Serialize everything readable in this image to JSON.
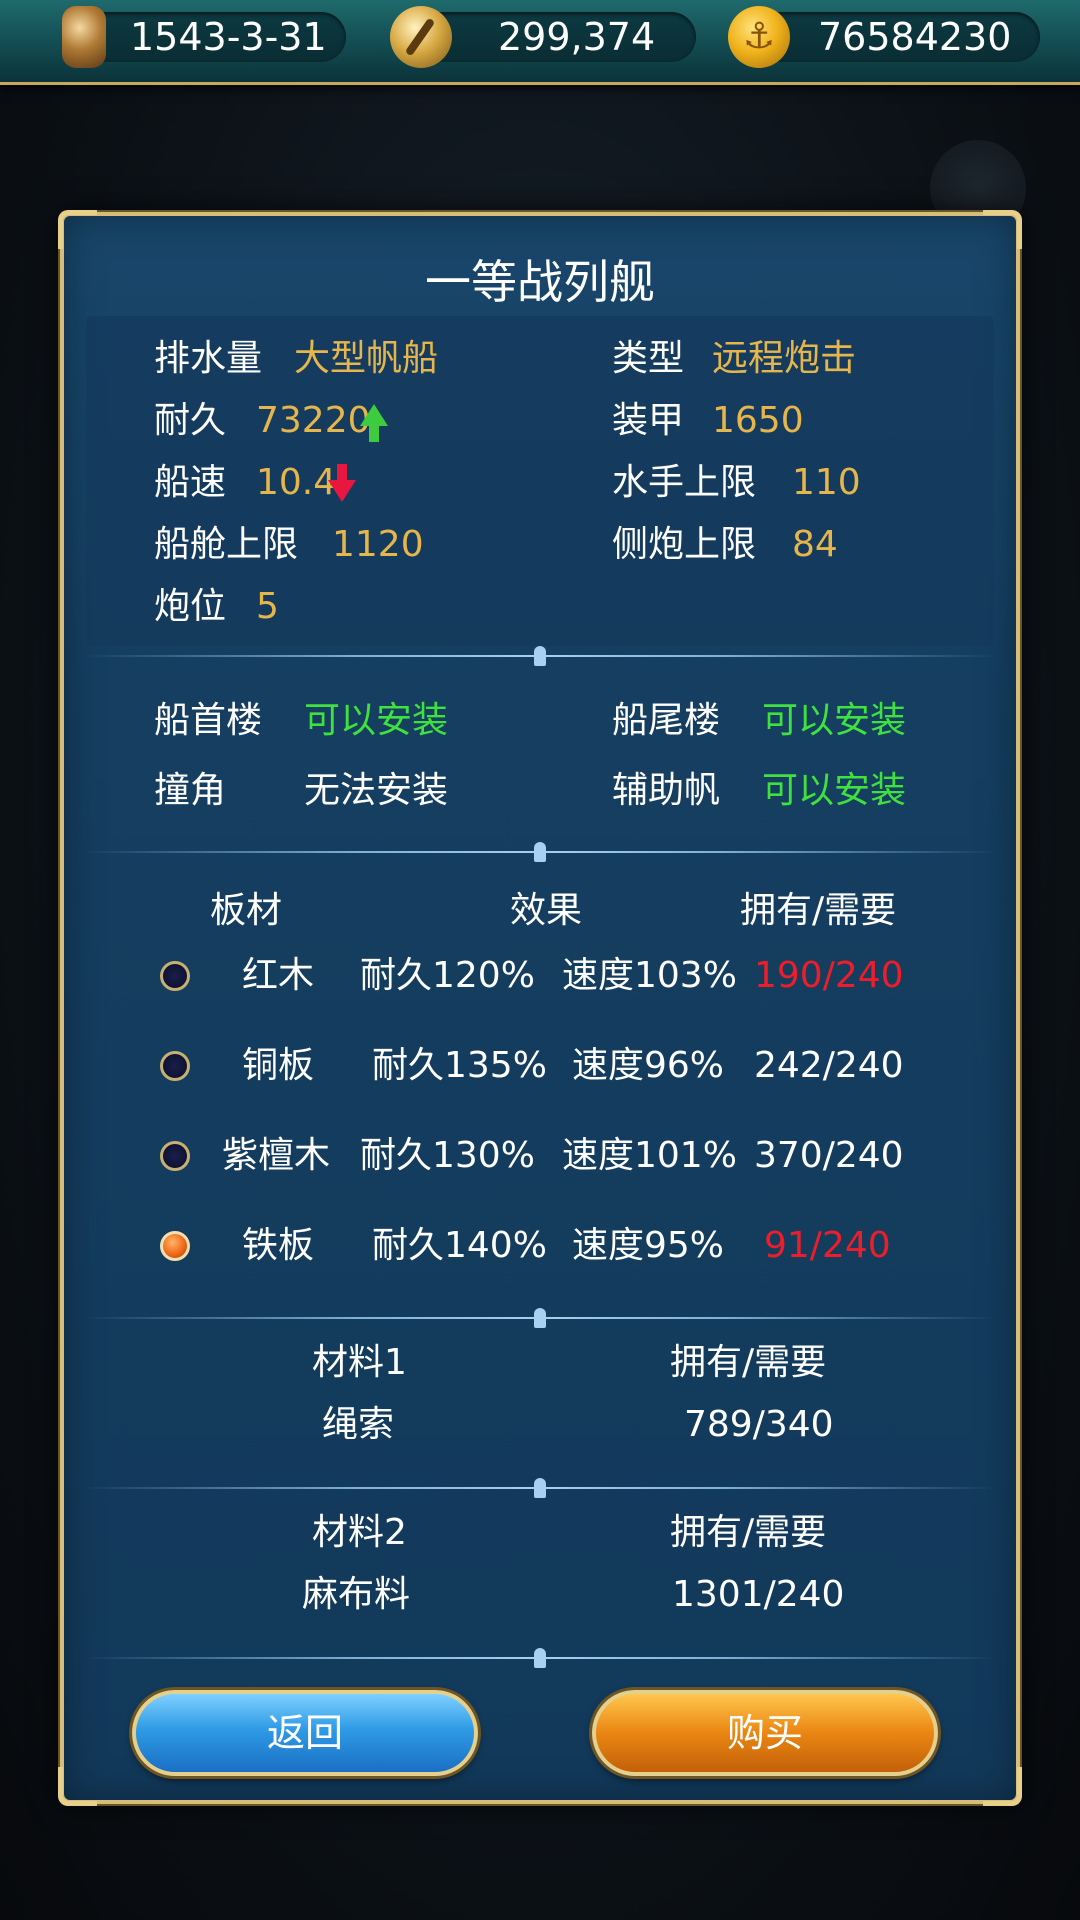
{
  "topbar": {
    "date": "1543-3-31",
    "reputation": "299,374",
    "gold": "76584230",
    "date_icon": "hourglass-icon",
    "reputation_icon": "compass-icon",
    "gold_icon": "anchor-coin-icon"
  },
  "panel": {
    "title": "一等战列舰",
    "stats": {
      "displacement_label": "排水量",
      "displacement_value": "大型帆船",
      "type_label": "类型",
      "type_value": "远程炮击",
      "durability_label": "耐久",
      "durability_value": "73220",
      "durability_trend": "up",
      "armor_label": "装甲",
      "armor_value": "1650",
      "speed_label": "船速",
      "speed_value": "10.4",
      "speed_trend": "down",
      "crew_label": "水手上限",
      "crew_value": "110",
      "cabin_label": "船舱上限",
      "cabin_value": "1120",
      "broadside_label": "侧炮上限",
      "broadside_value": "84",
      "gun_slots_label": "炮位",
      "gun_slots_value": "5"
    },
    "parts": {
      "bow_label": "船首楼",
      "bow_status": "可以安装",
      "stern_label": "船尾楼",
      "stern_status": "可以安装",
      "ram_label": "撞角",
      "ram_status": "无法安装",
      "aux_sail_label": "辅助帆",
      "aux_sail_status": "可以安装"
    },
    "planks": {
      "header_material": "板材",
      "header_effect": "效果",
      "header_owned": "拥有/需要",
      "rows": [
        {
          "name": "红木",
          "durability": "耐久120%",
          "speed": "速度103%",
          "count": "190/240",
          "sufficient": false,
          "selected": false
        },
        {
          "name": "铜板",
          "durability": "耐久135%",
          "speed": "速度96%",
          "count": "242/240",
          "sufficient": true,
          "selected": false
        },
        {
          "name": "紫檀木",
          "durability": "耐久130%",
          "speed": "速度101%",
          "count": "370/240",
          "sufficient": true,
          "selected": false
        },
        {
          "name": "铁板",
          "durability": "耐久140%",
          "speed": "速度95%",
          "count": "91/240",
          "sufficient": false,
          "selected": true
        }
      ]
    },
    "material1": {
      "header": "材料1",
      "owned_header": "拥有/需要",
      "name": "绳索",
      "count": "789/340"
    },
    "material2": {
      "header": "材料2",
      "owned_header": "拥有/需要",
      "name": "麻布料",
      "count": "1301/240"
    },
    "buttons": {
      "back": "返回",
      "buy": "购买"
    },
    "colors": {
      "gold": "#e6b64c",
      "green": "#3ee23e",
      "red": "#ee1d2a",
      "frame": "#d6bd7a"
    }
  }
}
